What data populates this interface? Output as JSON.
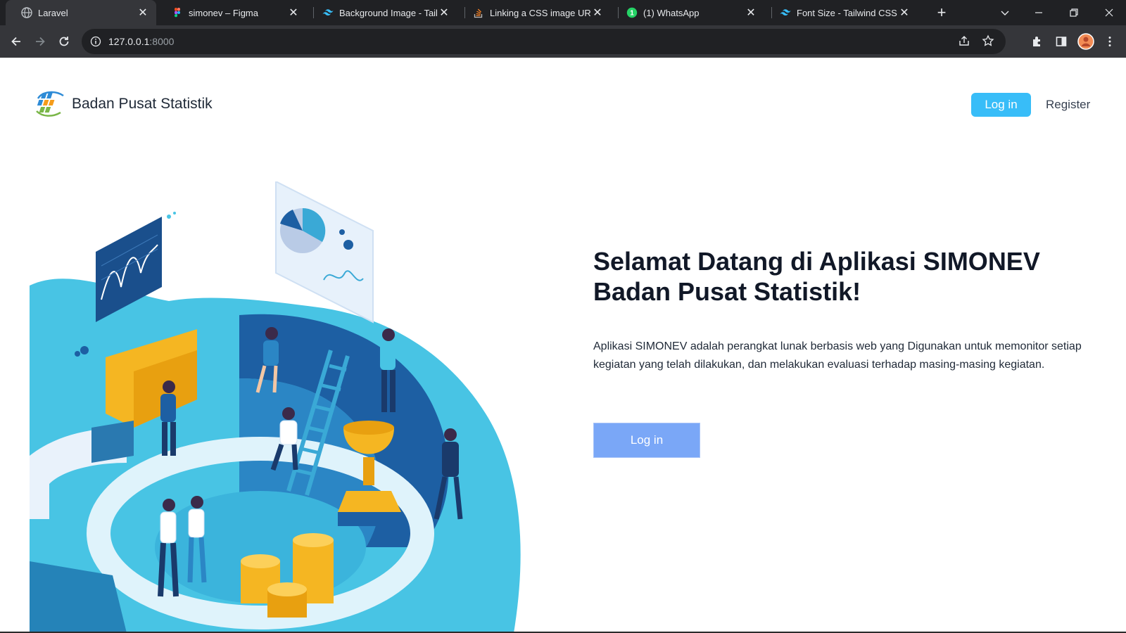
{
  "browser": {
    "tabs": [
      {
        "title": "Laravel",
        "favicon": "globe-icon",
        "active": true
      },
      {
        "title": "simonev – Figma",
        "favicon": "figma-icon",
        "active": false
      },
      {
        "title": "Background Image - Tailwi",
        "favicon": "tailwind-icon",
        "active": false
      },
      {
        "title": "Linking a CSS image URL i",
        "favicon": "stackoverflow-icon",
        "active": false
      },
      {
        "title": "(1) WhatsApp",
        "favicon": "whatsapp-icon",
        "active": false
      },
      {
        "title": "Font Size - Tailwind CSS",
        "favicon": "tailwind-icon",
        "active": false
      }
    ],
    "url_host": "127.0.0.1",
    "url_port": ":8000"
  },
  "header": {
    "brand_name": "Badan Pusat Statistik",
    "nav_login": "Log in",
    "nav_register": "Register"
  },
  "hero": {
    "title_line1": "Selamat Datang di Aplikasi SIMONEV",
    "title_line2": "Badan Pusat Statistik!",
    "description": "Aplikasi SIMONEV adalah perangkat lunak berbasis web yang Digunakan untuk memonitor setiap kegiatan yang telah dilakukan, dan melakukan evaluasi terhadap masing-masing kegiatan.",
    "login_label": "Log in"
  },
  "colors": {
    "accent": "#38bdf8",
    "hero_button": "#7aa7f7",
    "illustration_primary": "#1e6fb5",
    "illustration_secondary": "#4fc3e8",
    "illustration_gold": "#f5b622"
  }
}
